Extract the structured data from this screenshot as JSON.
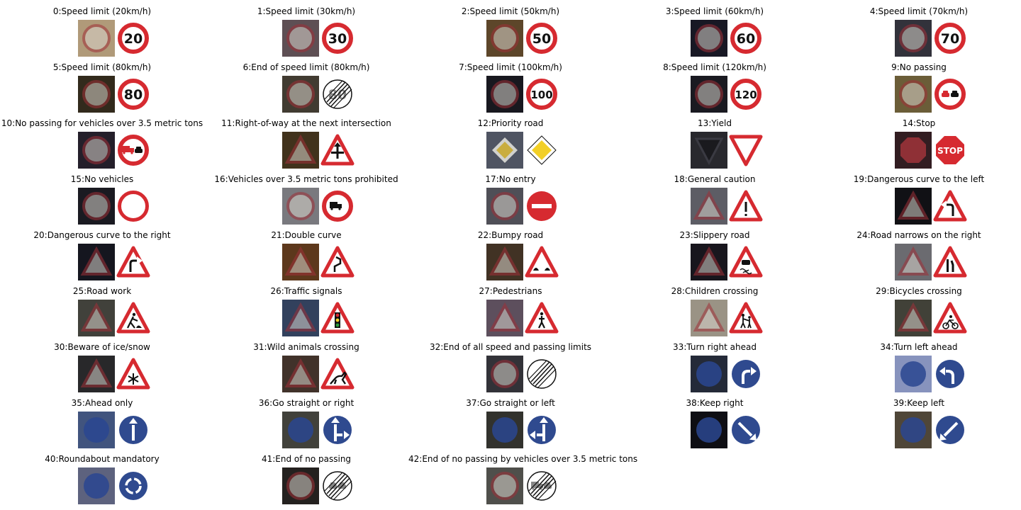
{
  "colors": {
    "red": "#d62a30",
    "blue": "#2f4a8f",
    "yellow": "#f2cf26",
    "black": "#111111",
    "white": "#ffffff"
  },
  "signs": [
    {
      "title": "0:Speed limit (20km/h)",
      "icon": "speed-limit",
      "text": "20",
      "photo": "#c9b08a"
    },
    {
      "title": "1:Speed limit (30km/h)",
      "icon": "speed-limit",
      "text": "30",
      "photo": "#6b5a60"
    },
    {
      "title": "2:Speed limit (50km/h)",
      "icon": "speed-limit",
      "text": "50",
      "photo": "#6a5030"
    },
    {
      "title": "3:Speed limit (60km/h)",
      "icon": "speed-limit",
      "text": "60",
      "photo": "#1c1c2a"
    },
    {
      "title": "4:Speed limit (70km/h)",
      "icon": "speed-limit",
      "text": "70",
      "photo": "#3a3a44"
    },
    {
      "title": "5:Speed limit (80km/h)",
      "icon": "speed-limit",
      "text": "80",
      "photo": "#3a3020"
    },
    {
      "title": "6:End of speed limit (80km/h)",
      "icon": "end-speed",
      "text": "80",
      "photo": "#4a4438"
    },
    {
      "title": "7:Speed limit (100km/h)",
      "icon": "speed-limit",
      "text": "100",
      "photo": "#1c1c24"
    },
    {
      "title": "8:Speed limit (120km/h)",
      "icon": "speed-limit",
      "text": "120",
      "photo": "#1e1e26"
    },
    {
      "title": "9:No passing",
      "icon": "no-passing",
      "text": "",
      "photo": "#7a6a40"
    },
    {
      "title": "10:No passing for vehicles over 3.5 metric tons",
      "icon": "no-passing-truck",
      "text": "",
      "photo": "#2a2430"
    },
    {
      "title": "11:Right-of-way at the next intersection",
      "icon": "right-of-way",
      "text": "",
      "photo": "#4a3a20"
    },
    {
      "title": "12:Priority road",
      "icon": "priority",
      "text": "",
      "photo": "#5a6070"
    },
    {
      "title": "13:Yield",
      "icon": "yield",
      "text": "",
      "photo": "#2e2e34"
    },
    {
      "title": "14:Stop",
      "icon": "stop",
      "text": "STOP",
      "photo": "#3a2226"
    },
    {
      "title": "15:No vehicles",
      "icon": "no-vehicles",
      "text": "",
      "photo": "#1e1e26"
    },
    {
      "title": "16:Vehicles over 3.5 metric tons prohibited",
      "icon": "truck-prohibited",
      "text": "",
      "photo": "#8a8a90"
    },
    {
      "title": "17:No entry",
      "icon": "no-entry",
      "text": "",
      "photo": "#5a5a64"
    },
    {
      "title": "18:General caution",
      "icon": "general-caution",
      "text": "",
      "photo": "#6a6a74"
    },
    {
      "title": "19:Dangerous curve to the left",
      "icon": "curve-left",
      "text": "",
      "photo": "#141418"
    },
    {
      "title": "20:Dangerous curve to the right",
      "icon": "curve-right",
      "text": "",
      "photo": "#181a24"
    },
    {
      "title": "21:Double curve",
      "icon": "double-curve",
      "text": "",
      "photo": "#6a4020"
    },
    {
      "title": "22:Bumpy road",
      "icon": "bumpy",
      "text": "",
      "photo": "#4a3a2a"
    },
    {
      "title": "23:Slippery road",
      "icon": "slippery",
      "text": "",
      "photo": "#1c1a22"
    },
    {
      "title": "24:Road narrows on the right",
      "icon": "narrows-right",
      "text": "",
      "photo": "#7a7a80"
    },
    {
      "title": "25:Road work",
      "icon": "road-work",
      "text": "",
      "photo": "#4a4a44"
    },
    {
      "title": "26:Traffic signals",
      "icon": "traffic-signals",
      "text": "",
      "photo": "#3a4a6a"
    },
    {
      "title": "27:Pedestrians",
      "icon": "pedestrians",
      "text": "",
      "photo": "#6a5a6a"
    },
    {
      "title": "28:Children crossing",
      "icon": "children",
      "text": "",
      "photo": "#b0a898"
    },
    {
      "title": "29:Bicycles crossing",
      "icon": "bicycles",
      "text": "",
      "photo": "#4a4a40"
    },
    {
      "title": "30:Beware of ice/snow",
      "icon": "ice-snow",
      "text": "",
      "photo": "#2e2e30"
    },
    {
      "title": "31:Wild animals crossing",
      "icon": "wild-animals",
      "text": "",
      "photo": "#4a3a30"
    },
    {
      "title": "32:End of all speed and passing limits",
      "icon": "end-all",
      "text": "",
      "photo": "#3a3a40"
    },
    {
      "title": "33:Turn right ahead",
      "icon": "turn-right",
      "text": "",
      "photo": "#2a3040"
    },
    {
      "title": "34:Turn left ahead",
      "icon": "turn-left",
      "text": "",
      "photo": "#9aa8d8"
    },
    {
      "title": "35:Ahead only",
      "icon": "ahead-only",
      "text": "",
      "photo": "#4a6090"
    },
    {
      "title": "36:Go straight or right",
      "icon": "straight-right",
      "text": "",
      "photo": "#4a4a44"
    },
    {
      "title": "37:Go straight or left",
      "icon": "straight-left",
      "text": "",
      "photo": "#3a3a34"
    },
    {
      "title": "38:Keep right",
      "icon": "keep-right",
      "text": "",
      "photo": "#101016"
    },
    {
      "title": "39:Keep left",
      "icon": "keep-left",
      "text": "",
      "photo": "#5a5040"
    },
    {
      "title": "40:Roundabout mandatory",
      "icon": "roundabout",
      "text": "",
      "photo": "#6a7090"
    },
    {
      "title": "41:End of no passing",
      "icon": "end-no-passing",
      "text": "",
      "photo": "#2a2624"
    },
    {
      "title": "42:End of no passing by vehicles over 3.5 metric tons",
      "icon": "end-no-passing-truck",
      "text": "",
      "photo": "#5a5a56"
    }
  ]
}
